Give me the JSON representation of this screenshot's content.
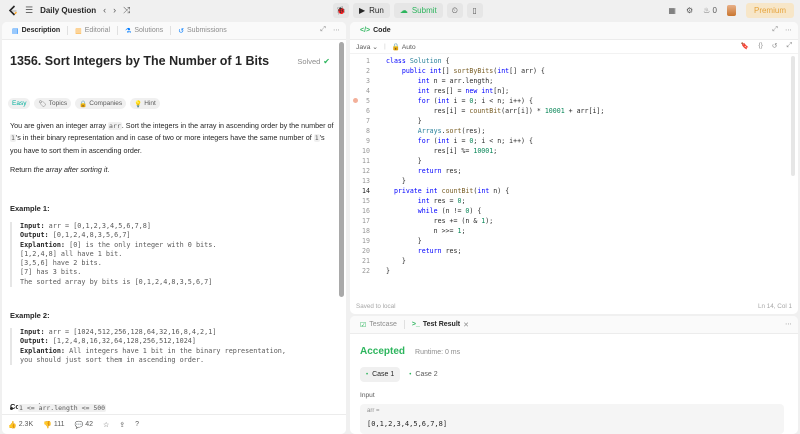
{
  "nav": {
    "title": "Daily Question",
    "run": "Run",
    "submit": "Submit",
    "fire_count": "0",
    "premium": "Premium"
  },
  "left_tabs": [
    "Description",
    "Editorial",
    "Solutions",
    "Submissions"
  ],
  "problem": {
    "title": "1356. Sort Integers by The Number of 1 Bits",
    "solved": "Solved",
    "chips": [
      "Easy",
      "Topics",
      "Companies",
      "Hint"
    ],
    "p1_a": "You are given an integer array ",
    "p1_code": "arr",
    "p1_b": ". Sort the integers in the array in ascending order by the number of ",
    "p1_code2": "1",
    "p1_c": "'s in their binary representation and in case of two or more integers have the same number of ",
    "p1_code3": "1",
    "p1_d": "'s you have to sort them in ascending order.",
    "p2_a": "Return ",
    "p2_em": "the array after sorting it",
    "p2_b": ".",
    "ex1_title": "Example 1:",
    "ex1_lines": [
      {
        "k": "Input:",
        "v": " arr = [0,1,2,3,4,5,6,7,8]"
      },
      {
        "k": "Output:",
        "v": " [0,1,2,4,8,3,5,6,7]"
      },
      {
        "k": "Explantion:",
        "v": " [0] is the only integer with 0 bits."
      },
      {
        "k": "",
        "v": "[1,2,4,8] all have 1 bit."
      },
      {
        "k": "",
        "v": "[3,5,6] have 2 bits."
      },
      {
        "k": "",
        "v": "[7] has 3 bits."
      },
      {
        "k": "",
        "v": "The sorted array by bits is [0,1,2,4,8,3,5,6,7]"
      }
    ],
    "ex2_title": "Example 2:",
    "ex2_lines": [
      {
        "k": "Input:",
        "v": " arr = [1024,512,256,128,64,32,16,8,4,2,1]"
      },
      {
        "k": "Output:",
        "v": " [1,2,4,8,16,32,64,128,256,512,1024]"
      },
      {
        "k": "Explantion:",
        "v": " All integers have 1 bit in the binary representation,"
      },
      {
        "k": "",
        "v": "you should just sort them in ascending order."
      }
    ],
    "constraints_title": "Constraints:",
    "constraint1": "1 <= arr.length <= 500"
  },
  "footer": {
    "likes": "2.3K",
    "dislikes": "111",
    "comments": "42"
  },
  "code_tab": "Code",
  "editor": {
    "language": "Java",
    "mode": "Auto",
    "saved": "Saved to local",
    "cursor": "Ln 14, Col 1",
    "lines": [
      "class Solution {",
      "    public int[] sortByBits(int[] arr) {",
      "        int n = arr.length;",
      "        int res[] = new int[n];",
      "        for (int i = 0; i < n; i++) {",
      "            res[i] = countBit(arr[i]) * 10001 + arr[i];",
      "        }",
      "        Arrays.sort(res);",
      "        for (int i = 0; i < n; i++) {",
      "            res[i] %= 10001;",
      "        }",
      "        return res;",
      "    }",
      "  private int countBit(int n) {",
      "        int res = 0;",
      "        while (n != 0) {",
      "            res += (n & 1);",
      "            n >>= 1;",
      "        }",
      "        return res;",
      "    }",
      "}"
    ]
  },
  "test": {
    "tab1": "Testcase",
    "tab2": "Test Result",
    "status": "Accepted",
    "runtime": "Runtime: 0 ms",
    "case1": "Case 1",
    "case2": "Case 2",
    "input_label": "Input",
    "var_name": "arr =",
    "var_value": "[0,1,2,3,4,5,6,7,8]"
  },
  "colors": {
    "accent_green": "#2db55d",
    "easy": "#00af9b",
    "premium": "#e5a33b"
  }
}
